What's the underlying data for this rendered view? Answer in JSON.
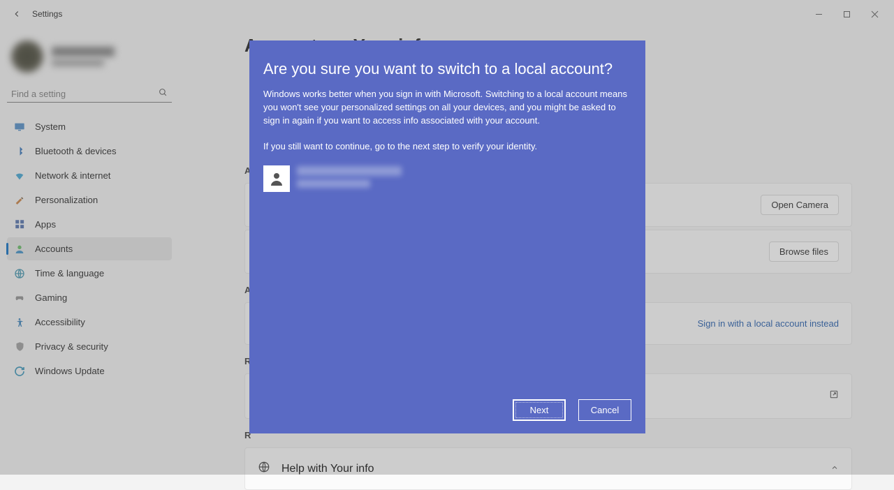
{
  "titlebar": {
    "app_name": "Settings"
  },
  "search": {
    "placeholder": "Find a setting"
  },
  "nav": {
    "items": [
      {
        "label": "System"
      },
      {
        "label": "Bluetooth & devices"
      },
      {
        "label": "Network & internet"
      },
      {
        "label": "Personalization"
      },
      {
        "label": "Apps"
      },
      {
        "label": "Accounts"
      },
      {
        "label": "Time & language"
      },
      {
        "label": "Gaming"
      },
      {
        "label": "Accessibility"
      },
      {
        "label": "Privacy & security"
      },
      {
        "label": "Windows Update"
      }
    ]
  },
  "page": {
    "heading_visible_left": "A",
    "heading_visible_right": "Y",
    "section_adjust_photo": "A",
    "section_account": "A",
    "section_related": "R",
    "section_related2": "R",
    "open_camera": "Open Camera",
    "browse_files": "Browse files",
    "sign_in_local": "Sign in with a local account instead",
    "help": "Help with Your info"
  },
  "dialog": {
    "title": "Are you sure you want to switch to a local account?",
    "para1": "Windows works better when you sign in with Microsoft. Switching to a local account means you won't see your personalized settings on all your devices, and you might be asked to sign in again if you want to access info associated with your account.",
    "para2": "If you still want to continue, go to the next step to verify your identity.",
    "next": "Next",
    "cancel": "Cancel"
  }
}
